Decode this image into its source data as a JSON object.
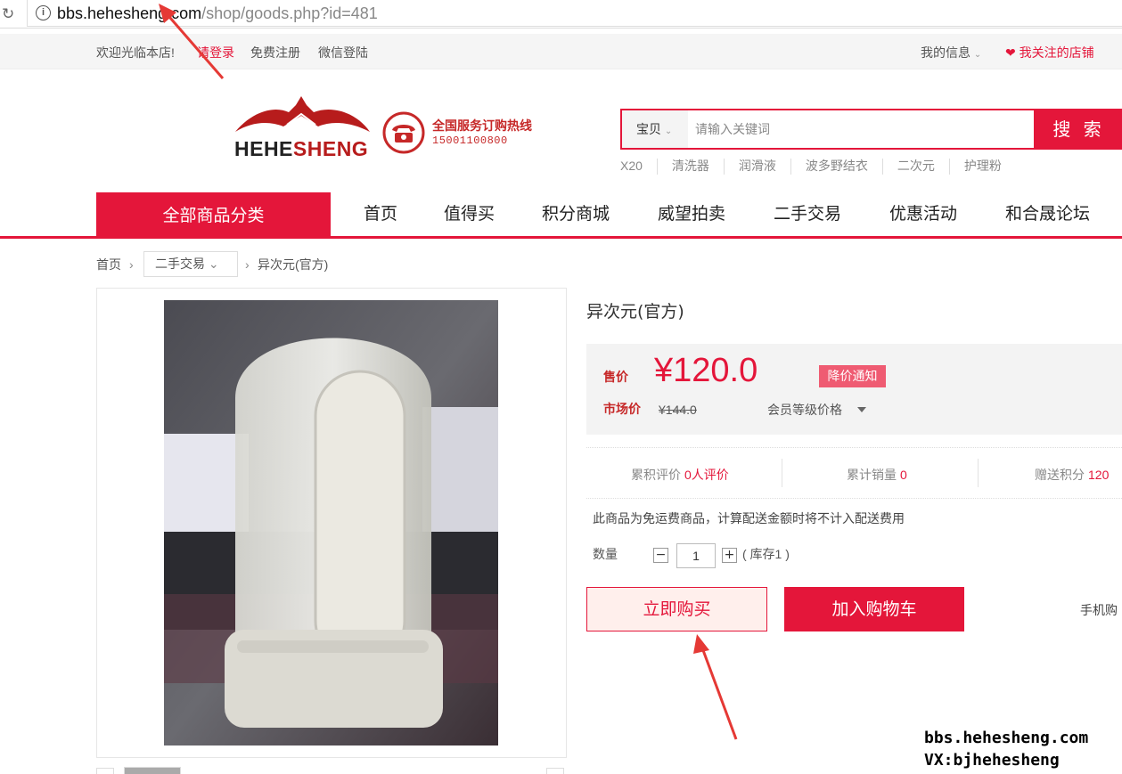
{
  "browser": {
    "url_host": "bbs.hehesheng.com",
    "url_path": "/shop/goods.php?id=481"
  },
  "topbar": {
    "welcome": "欢迎光临本店!",
    "login": "请登录",
    "register": "免费注册",
    "wechat_login": "微信登陆",
    "my_info": "我的信息",
    "my_followed_shops": "我关注的店铺"
  },
  "header": {
    "logo_text_a": "HEHE",
    "logo_text_b": "SHENG",
    "hotline_title": "全国服务订购热线",
    "hotline_number": "15001100800"
  },
  "search": {
    "scope": "宝贝",
    "placeholder": "请输入关键词",
    "button": "搜 索",
    "hot_words": [
      "X20",
      "清洗器",
      "润滑液",
      "波多野结衣",
      "二次元",
      "护理粉"
    ]
  },
  "nav": {
    "all_categories": "全部商品分类",
    "items": [
      "首页",
      "值得买",
      "积分商城",
      "威望拍卖",
      "二手交易",
      "优惠活动",
      "和合晟论坛"
    ]
  },
  "breadcrumb": {
    "home": "首页",
    "category": "二手交易",
    "current": "异次元(官方)"
  },
  "product": {
    "title": "异次元(官方)",
    "price_label": "售价",
    "price": "¥120.0",
    "price_alert": "降价通知",
    "market_label": "市场价",
    "market_price": "¥144.0",
    "member_price": "会员等级价格",
    "stats": {
      "reviews_label": "累积评价",
      "reviews_value": "0人评价",
      "sales_label": "累计销量",
      "sales_value": "0",
      "points_label": "赠送积分",
      "points_value": "120"
    },
    "shipping_note": "此商品为免运费商品，计算配送金额时将不计入配送费用",
    "quantity_label": "数量",
    "quantity": "1",
    "stock": "( 库存1 )",
    "buy_now": "立即购买",
    "add_to_cart": "加入购物车",
    "mobile_buy": "手机购"
  },
  "watermark": {
    "line1": "bbs.hehesheng.com",
    "line2": "VX:bjhehesheng"
  },
  "colors": {
    "accent": "#e4163a",
    "price_panel": "#f3f3f3"
  }
}
